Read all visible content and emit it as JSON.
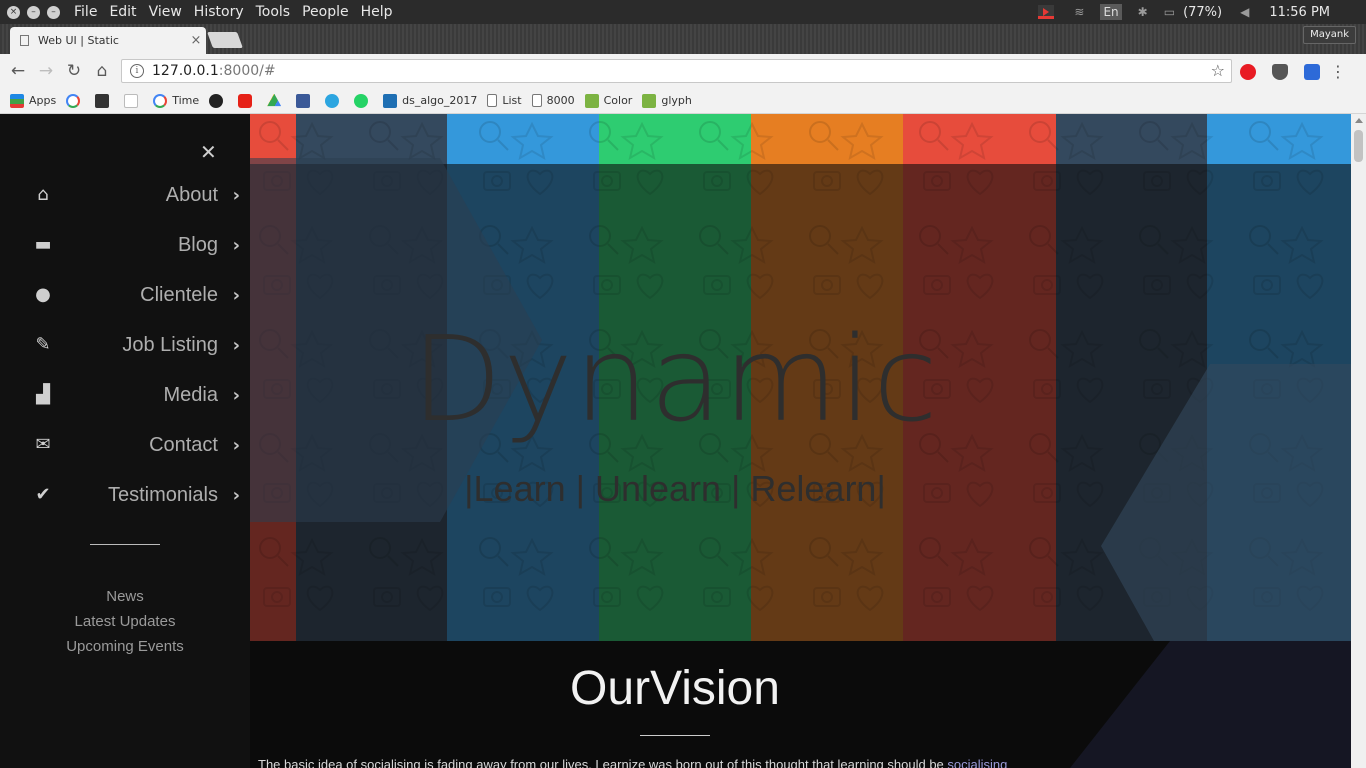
{
  "os": {
    "menu": [
      "File",
      "Edit",
      "View",
      "History",
      "Tools",
      "People",
      "Help"
    ],
    "keyboard_layout": "En",
    "battery": "(77%)",
    "time": "11:56 PM"
  },
  "browser": {
    "tab_title": "Web UI | Static",
    "profile": "Mayank",
    "url_host": "127.0.0.1",
    "url_rest": ":8000/#",
    "bookmarks": [
      "Apps",
      "",
      "",
      "",
      "Time",
      "",
      "",
      "",
      "",
      "",
      "",
      "ds_algo_2017",
      "List",
      "8000",
      "Color",
      "glyph"
    ]
  },
  "sidebar": {
    "items": [
      {
        "label": "About",
        "icon": "home-icon"
      },
      {
        "label": "Blog",
        "icon": "comment-icon"
      },
      {
        "label": "Clientele",
        "icon": "user-icon"
      },
      {
        "label": "Job Listing",
        "icon": "pencil-icon"
      },
      {
        "label": "Media",
        "icon": "signal-icon"
      },
      {
        "label": "Contact",
        "icon": "envelope-icon"
      },
      {
        "label": "Testimonials",
        "icon": "check-icon"
      }
    ],
    "links": [
      "News",
      "Latest Updates",
      "Upcoming Events"
    ]
  },
  "hero": {
    "title": "Dynamic",
    "subtitle": "|Learn | Unlearn | Relearn|",
    "stripe_colors": [
      "#e74c3c",
      "#34495e",
      "#3498db",
      "#2ecc71",
      "#e67e22",
      "#e74c3c",
      "#34495e",
      "#3498db"
    ]
  },
  "vision": {
    "heading": "OurVision",
    "text": "The basic idea of socialising is fading away from our lives. Learnize was born out of this thought that learning should be ",
    "link": "socialising"
  }
}
